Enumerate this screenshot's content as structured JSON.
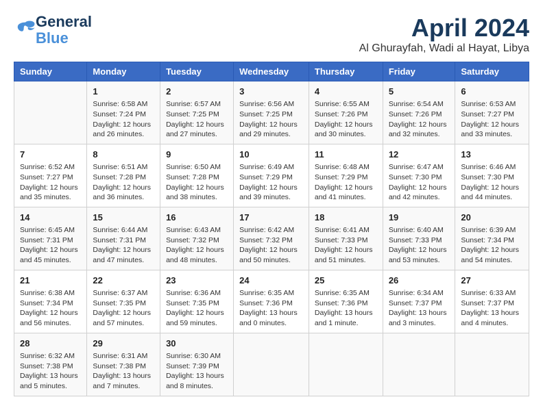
{
  "logo": {
    "line1": "General",
    "line2": "Blue"
  },
  "title": "April 2024",
  "location": "Al Ghurayfah, Wadi al Hayat, Libya",
  "days_of_week": [
    "Sunday",
    "Monday",
    "Tuesday",
    "Wednesday",
    "Thursday",
    "Friday",
    "Saturday"
  ],
  "weeks": [
    [
      {
        "day": "",
        "info": ""
      },
      {
        "day": "1",
        "info": "Sunrise: 6:58 AM\nSunset: 7:24 PM\nDaylight: 12 hours\nand 26 minutes."
      },
      {
        "day": "2",
        "info": "Sunrise: 6:57 AM\nSunset: 7:25 PM\nDaylight: 12 hours\nand 27 minutes."
      },
      {
        "day": "3",
        "info": "Sunrise: 6:56 AM\nSunset: 7:25 PM\nDaylight: 12 hours\nand 29 minutes."
      },
      {
        "day": "4",
        "info": "Sunrise: 6:55 AM\nSunset: 7:26 PM\nDaylight: 12 hours\nand 30 minutes."
      },
      {
        "day": "5",
        "info": "Sunrise: 6:54 AM\nSunset: 7:26 PM\nDaylight: 12 hours\nand 32 minutes."
      },
      {
        "day": "6",
        "info": "Sunrise: 6:53 AM\nSunset: 7:27 PM\nDaylight: 12 hours\nand 33 minutes."
      }
    ],
    [
      {
        "day": "7",
        "info": "Sunrise: 6:52 AM\nSunset: 7:27 PM\nDaylight: 12 hours\nand 35 minutes."
      },
      {
        "day": "8",
        "info": "Sunrise: 6:51 AM\nSunset: 7:28 PM\nDaylight: 12 hours\nand 36 minutes."
      },
      {
        "day": "9",
        "info": "Sunrise: 6:50 AM\nSunset: 7:28 PM\nDaylight: 12 hours\nand 38 minutes."
      },
      {
        "day": "10",
        "info": "Sunrise: 6:49 AM\nSunset: 7:29 PM\nDaylight: 12 hours\nand 39 minutes."
      },
      {
        "day": "11",
        "info": "Sunrise: 6:48 AM\nSunset: 7:29 PM\nDaylight: 12 hours\nand 41 minutes."
      },
      {
        "day": "12",
        "info": "Sunrise: 6:47 AM\nSunset: 7:30 PM\nDaylight: 12 hours\nand 42 minutes."
      },
      {
        "day": "13",
        "info": "Sunrise: 6:46 AM\nSunset: 7:30 PM\nDaylight: 12 hours\nand 44 minutes."
      }
    ],
    [
      {
        "day": "14",
        "info": "Sunrise: 6:45 AM\nSunset: 7:31 PM\nDaylight: 12 hours\nand 45 minutes."
      },
      {
        "day": "15",
        "info": "Sunrise: 6:44 AM\nSunset: 7:31 PM\nDaylight: 12 hours\nand 47 minutes."
      },
      {
        "day": "16",
        "info": "Sunrise: 6:43 AM\nSunset: 7:32 PM\nDaylight: 12 hours\nand 48 minutes."
      },
      {
        "day": "17",
        "info": "Sunrise: 6:42 AM\nSunset: 7:32 PM\nDaylight: 12 hours\nand 50 minutes."
      },
      {
        "day": "18",
        "info": "Sunrise: 6:41 AM\nSunset: 7:33 PM\nDaylight: 12 hours\nand 51 minutes."
      },
      {
        "day": "19",
        "info": "Sunrise: 6:40 AM\nSunset: 7:33 PM\nDaylight: 12 hours\nand 53 minutes."
      },
      {
        "day": "20",
        "info": "Sunrise: 6:39 AM\nSunset: 7:34 PM\nDaylight: 12 hours\nand 54 minutes."
      }
    ],
    [
      {
        "day": "21",
        "info": "Sunrise: 6:38 AM\nSunset: 7:34 PM\nDaylight: 12 hours\nand 56 minutes."
      },
      {
        "day": "22",
        "info": "Sunrise: 6:37 AM\nSunset: 7:35 PM\nDaylight: 12 hours\nand 57 minutes."
      },
      {
        "day": "23",
        "info": "Sunrise: 6:36 AM\nSunset: 7:35 PM\nDaylight: 12 hours\nand 59 minutes."
      },
      {
        "day": "24",
        "info": "Sunrise: 6:35 AM\nSunset: 7:36 PM\nDaylight: 13 hours\nand 0 minutes."
      },
      {
        "day": "25",
        "info": "Sunrise: 6:35 AM\nSunset: 7:36 PM\nDaylight: 13 hours\nand 1 minute."
      },
      {
        "day": "26",
        "info": "Sunrise: 6:34 AM\nSunset: 7:37 PM\nDaylight: 13 hours\nand 3 minutes."
      },
      {
        "day": "27",
        "info": "Sunrise: 6:33 AM\nSunset: 7:37 PM\nDaylight: 13 hours\nand 4 minutes."
      }
    ],
    [
      {
        "day": "28",
        "info": "Sunrise: 6:32 AM\nSunset: 7:38 PM\nDaylight: 13 hours\nand 5 minutes."
      },
      {
        "day": "29",
        "info": "Sunrise: 6:31 AM\nSunset: 7:38 PM\nDaylight: 13 hours\nand 7 minutes."
      },
      {
        "day": "30",
        "info": "Sunrise: 6:30 AM\nSunset: 7:39 PM\nDaylight: 13 hours\nand 8 minutes."
      },
      {
        "day": "",
        "info": ""
      },
      {
        "day": "",
        "info": ""
      },
      {
        "day": "",
        "info": ""
      },
      {
        "day": "",
        "info": ""
      }
    ]
  ]
}
